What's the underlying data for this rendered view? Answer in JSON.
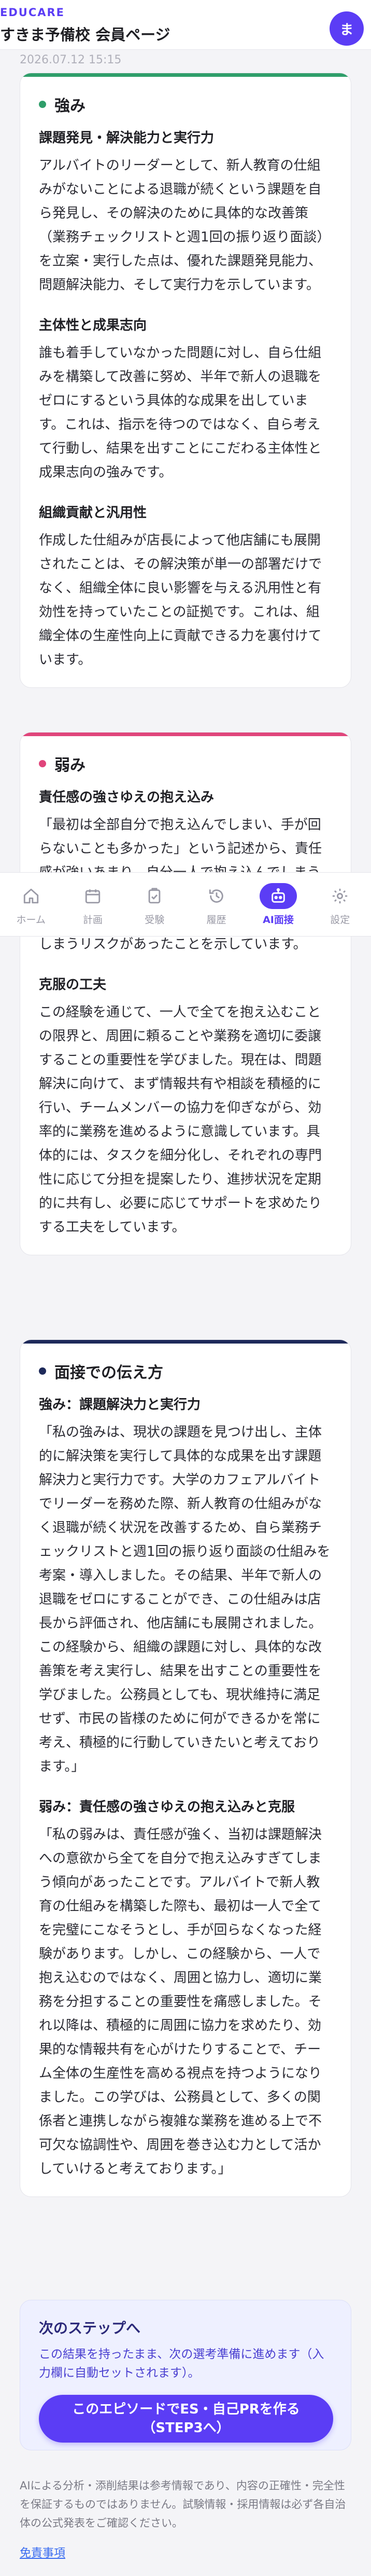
{
  "header": {
    "brand": "EDUCARE",
    "title": "すきま予備校 会員ページ",
    "avatar_initial": "ま",
    "date_partial": "2026.07.12 15:15"
  },
  "strengths": {
    "title": "強み",
    "accent_color": "#2f9e6a",
    "sections": [
      {
        "heading": "課題発見・解決能力と実行力",
        "body": "アルバイトのリーダーとして、新人教育の仕組みがないことによる退職が続くという課題を自ら発見し、その解決のために具体的な改善策（業務チェックリストと週1回の振り返り面談）を立案・実行した点は、優れた課題発見能力、問題解決能力、そして実行力を示しています。"
      },
      {
        "heading": "主体性と成果志向",
        "body": "誰も着手していなかった問題に対し、自ら仕組みを構築して改善に努め、半年で新人の退職をゼロにするという具体的な成果を出しています。これは、指示を待つのではなく、自ら考えて行動し、結果を出すことにこだわる主体性と成果志向の強みです。"
      },
      {
        "heading": "組織貢献と汎用性",
        "body": "作成した仕組みが店長によって他店舗にも展開されたことは、その解決策が単一の部署だけでなく、組織全体に良い影響を与える汎用性と有効性を持っていたことの証拠です。これは、組織全体の生産性向上に貢献できる力を裏付けています。"
      }
    ]
  },
  "weaknesses": {
    "title": "弱み",
    "accent_color": "#e0457b",
    "sections": [
      {
        "heading": "責任感の強さゆえの抱え込み",
        "body": "「最初は全部自分で抱え込んでしまい、手が回らないことも多かった」という記述から、責任感が強いあまり、自分一人で抱え込んでしまう傾向が見受けられます。その結果、リソース配分がうまくいかず、かえって業務効率を下げてしまうリスクがあったことを示しています。"
      },
      {
        "heading": "克服の工夫",
        "body": "この経験を通じて、一人で全てを抱え込むことの限界と、周囲に頼ることや業務を適切に委譲することの重要性を学びました。現在は、問題解決に向けて、まず情報共有や相談を積極的に行い、チームメンバーの協力を仰ぎながら、効率的に業務を進めるように意識しています。具体的には、タスクを細分化し、それぞれの専門性に応じて分担を提案したり、進捗状況を定期的に共有し、必要に応じてサポートを求めたりする工夫をしています。"
      }
    ]
  },
  "interview": {
    "title": "面接での伝え方",
    "accent_color": "#1e2a5a",
    "sections": [
      {
        "heading": "強み：課題解決力と実行力",
        "body": "「私の強みは、現状の課題を見つけ出し、主体的に解決策を実行して具体的な成果を出す課題解決力と実行力です。大学のカフェアルバイトでリーダーを務めた際、新人教育の仕組みがなく退職が続く状況を改善するため、自ら業務チェックリストと週1回の振り返り面談の仕組みを考案・導入しました。その結果、半年で新人の退職をゼロにすることができ、この仕組みは店長から評価され、他店舗にも展開されました。この経験から、組織の課題に対し、具体的な改善策を考え実行し、結果を出すことの重要性を学びました。公務員としても、現状維持に満足せず、市民の皆様のために何ができるかを常に考え、積極的に行動していきたいと考えております。」"
      },
      {
        "heading": "弱み：責任感の強さゆえの抱え込みと克服",
        "body": "「私の弱みは、責任感が強く、当初は課題解決への意欲から全てを自分で抱え込みすぎてしまう傾向があったことです。アルバイトで新人教育の仕組みを構築した際も、最初は一人で全てを完璧にこなそうとし、手が回らなくなった経験があります。しかし、この経験から、一人で抱え込むのではなく、周囲と協力し、適切に業務を分担することの重要性を痛感しました。それ以降は、積極的に周囲に協力を求めたり、効果的な情報共有を心がけたりすることで、チーム全体の生産性を高める視点を持つようになりました。この学びは、公務員として、多くの関係者と連携しながら複雑な業務を進める上で不可欠な協調性や、周囲を巻き込む力として活かしていけると考えております。」"
      }
    ]
  },
  "bottom_nav": {
    "items": [
      {
        "label": "ホーム",
        "icon": "home-icon",
        "active": false
      },
      {
        "label": "計画",
        "icon": "calendar-icon",
        "active": false
      },
      {
        "label": "受験",
        "icon": "clipboard-check-icon",
        "active": false
      },
      {
        "label": "履歴",
        "icon": "history-icon",
        "active": false
      },
      {
        "label": "AI面接",
        "icon": "robot-icon",
        "active": true
      },
      {
        "label": "設定",
        "icon": "gear-icon",
        "active": false
      }
    ],
    "active_color": "#5b3df5"
  },
  "next_step": {
    "title": "次のステップへ",
    "description": "この結果を持ったまま、次の選考準備に進めます（入力欄に自動セットされます）。",
    "cta_line1": "このエピソードでES・自己PRを作る",
    "cta_line2": "（STEP3へ）"
  },
  "footer": {
    "note": "AIによる分析・添削結果は参考情報であり、内容の正確性・完全性を保証するものではありません。試験情報・採用情報は必ず各自治体の公式発表をご確認ください。",
    "disclaimer_link": "免責事項"
  },
  "colors": {
    "brand": "#5b3df5",
    "link": "#3a6cf0"
  }
}
